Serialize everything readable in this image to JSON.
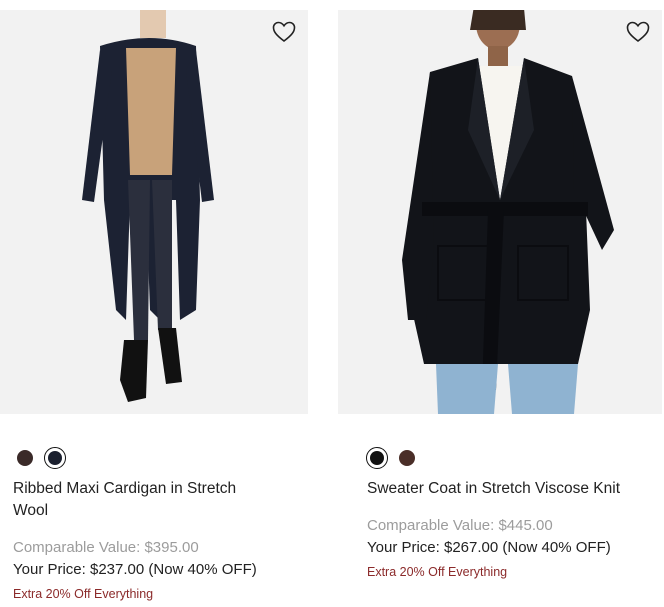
{
  "products": [
    {
      "name": "Ribbed Maxi Cardigan in Stretch Wool",
      "comparable": "Comparable Value: $395.00",
      "price": "Your Price: $237.00 (Now 40% OFF)",
      "promo": "Extra 20% Off Everything",
      "swatches": [
        {
          "color": "#3a2a28",
          "selected": false
        },
        {
          "color": "#1a1f2e",
          "selected": true
        }
      ]
    },
    {
      "name": "Sweater Coat in Stretch Viscose Knit",
      "comparable": "Comparable Value: $445.00",
      "price": "Your Price: $267.00 (Now 40% OFF)",
      "promo": "Extra 20% Off Everything",
      "swatches": [
        {
          "color": "#111111",
          "selected": true
        },
        {
          "color": "#4a2e28",
          "selected": false
        }
      ]
    }
  ],
  "icons": {
    "favorite": "heart-outline-icon"
  },
  "colors": {
    "promo": "#8b2a2a",
    "comparable": "#9c9c9c",
    "image_bg": "#f2f2f2"
  }
}
